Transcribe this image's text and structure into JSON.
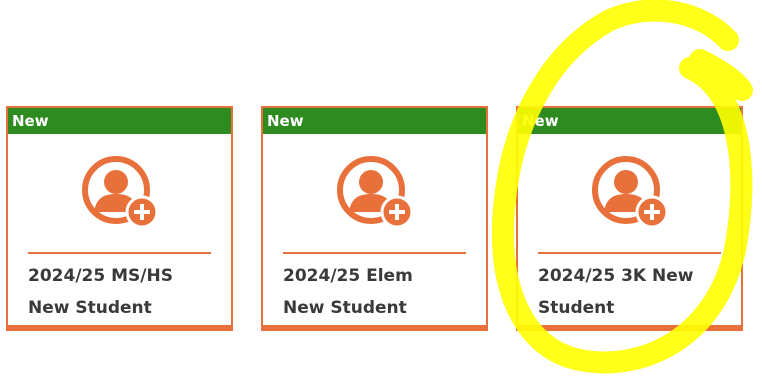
{
  "colors": {
    "accent": "#E8703A",
    "badge": "#2E8B1F",
    "highlight": "#FFFF00"
  },
  "cards": [
    {
      "badge": "New",
      "icon": "add-user-icon",
      "title": "2024/25 MS/HS\nNew Student"
    },
    {
      "badge": "New",
      "icon": "add-user-icon",
      "title": "2024/25 Elem\nNew Student"
    },
    {
      "badge": "New",
      "icon": "add-user-icon",
      "title": "2024/25 3K New\nStudent"
    }
  ]
}
